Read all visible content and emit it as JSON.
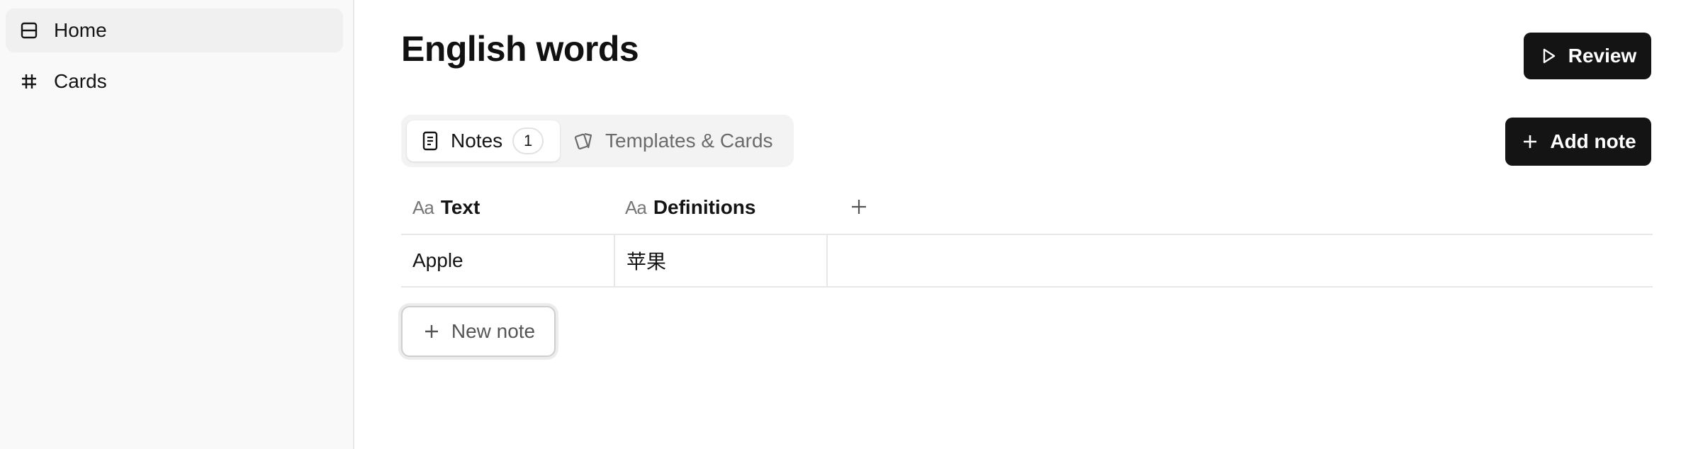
{
  "sidebar": {
    "items": [
      {
        "label": "Home",
        "icon": "layout-icon",
        "active": true
      },
      {
        "label": "Cards",
        "icon": "hash-icon",
        "active": false
      }
    ]
  },
  "page": {
    "title": "English words",
    "review_label": "Review",
    "add_note_label": "Add note",
    "new_note_label": "New note"
  },
  "tabs": [
    {
      "label": "Notes",
      "count": "1",
      "icon": "note-icon",
      "selected": true
    },
    {
      "label": "Templates & Cards",
      "icon": "cards-icon",
      "selected": false
    }
  ],
  "table": {
    "columns": [
      {
        "type_icon": "Aa",
        "label": "Text"
      },
      {
        "type_icon": "Aa",
        "label": "Definitions"
      }
    ],
    "rows": [
      [
        "Apple",
        "苹果"
      ]
    ]
  },
  "colors": {
    "primary_button": "#141414",
    "sidebar_bg": "#f9f9f9",
    "border": "#e7e7e7"
  }
}
